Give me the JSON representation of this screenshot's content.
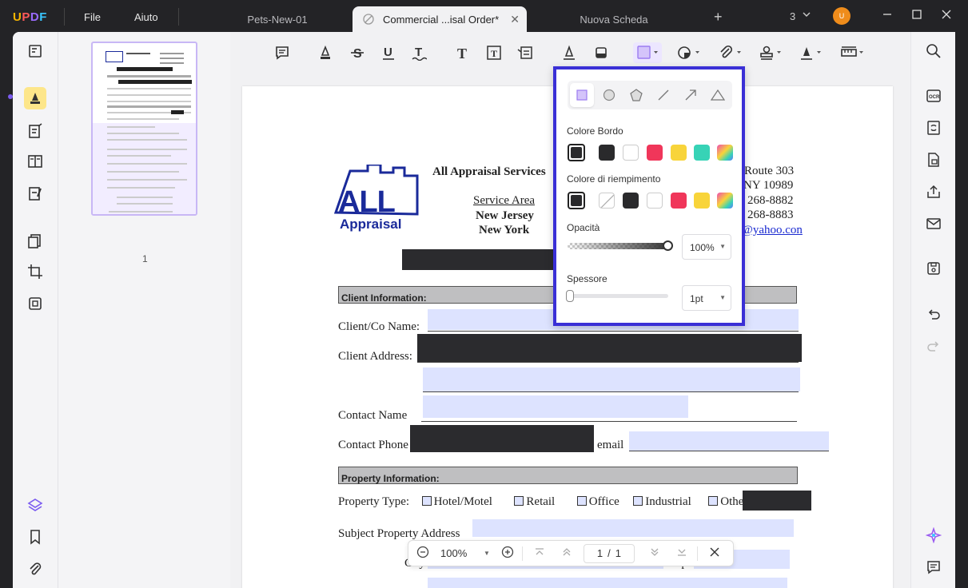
{
  "app": {
    "logo": "UPDF"
  },
  "menu": {
    "file": "File",
    "help": "Aiuto"
  },
  "tabs": [
    {
      "label": "Pets-New-01"
    },
    {
      "label": "Commercial ...isal Order*"
    },
    {
      "label": "Nuova Scheda"
    }
  ],
  "tab_count": "3",
  "avatar_initial": "U",
  "thumbnail": {
    "page_label": "1"
  },
  "document": {
    "company": "All Appraisal Services",
    "service_area": "Service Area",
    "state": "New Jersey",
    "city_state": "New York",
    "route": "Route 303",
    "zip": "NY 10989",
    "phone1": "268-8882",
    "phone2": "268-8883",
    "email_domain": "@yahoo.con",
    "logo_all": "ALL",
    "logo_appraisal": "Appraisal",
    "section_client": "Client Information:",
    "client_name": "Client/Co Name:",
    "client_address": "Client Address:",
    "contact_name": "Contact Name",
    "contact_phone": "Contact Phone",
    "email_label": "email",
    "section_property": "Property Information:",
    "property_type": "Property Type:",
    "opt_hotel": "Hotel/Motel",
    "opt_retail": "Retail",
    "opt_office": "Office",
    "opt_industrial": "Industrial",
    "opt_other": "Othe",
    "subject_address": "Subject Property Address",
    "city_label": "City",
    "zip_label": "Zip"
  },
  "bottom_nav": {
    "zoom": "100%",
    "page_current": "1",
    "page_sep": "/",
    "page_total": "1"
  },
  "popup": {
    "border_color_label": "Colore Bordo",
    "fill_color_label": "Colore di riempimento",
    "opacity_label": "Opacità",
    "opacity_value": "100%",
    "thickness_label": "Spessore",
    "thickness_value": "1pt",
    "border_colors": [
      "#2a2a2c",
      "#2a2a2c",
      "#ffffff",
      "#f0365a",
      "#f8d43a",
      "#37d3b6",
      "gradient"
    ],
    "fill_colors": [
      "#2a2a2c",
      "none",
      "#2a2a2c",
      "#ffffff",
      "#f0365a",
      "#f8d43a",
      "gradient"
    ]
  }
}
